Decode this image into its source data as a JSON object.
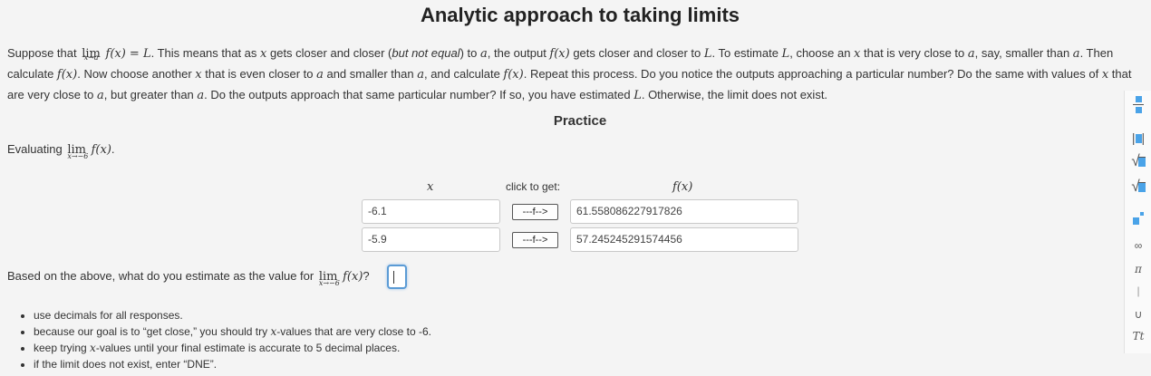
{
  "title": "Analytic approach to taking limits",
  "intro": {
    "s1a": "Suppose that ",
    "lim_word": "lim",
    "lim_sub": "x→a",
    "s1b": "f(x) = L",
    "s1c": ". This means that as ",
    "x": "x",
    "s1d": " gets closer and closer (",
    "s1e": "but not equal",
    "s1f": ") to ",
    "a": "a",
    "s1g": ", the output ",
    "fx": "f(x)",
    "s1h": " gets closer and closer to ",
    "L": "L",
    "s1i": ". To estimate ",
    "s1j": ", choose an ",
    "s1k": " that is very close to ",
    "s1l": ", say, smaller than ",
    "s1m": ". Then calculate ",
    "s2a": ". Now choose another ",
    "s2b": " that is even closer to ",
    "s2c": " and smaller than ",
    "s2d": ", and calculate ",
    "s2e": ". Repeat this process. Do you notice the outputs approaching a particular number? Do the same with values of ",
    "s2f": " that are very close to ",
    "s2g": ", but greater than ",
    "s2h": ". Do the outputs approach that same particular number? If so, you have estimated ",
    "s2i": ". Otherwise, the limit does not exist."
  },
  "practice_heading": "Practice",
  "evaluating": {
    "label": "Evaluating ",
    "lim_word": "lim",
    "lim_sub": "x→−6",
    "expr": "f(x)",
    "end": "."
  },
  "table": {
    "col_x": "x",
    "col_click": "click to get:",
    "col_f": "f(x)",
    "rows": [
      {
        "x": "-6.1",
        "button": "---f-->",
        "fx": "61.558086227917826"
      },
      {
        "x": "-5.9",
        "button": "---f-->",
        "fx": "57.245245291574456"
      }
    ]
  },
  "question": {
    "text": "Based on the above, what do you estimate as the value for ",
    "lim_word": "lim",
    "lim_sub": "x→−6",
    "expr": "f(x)",
    "end": "?",
    "answer_value": ""
  },
  "hints": {
    "h1": "use decimals for all responses.",
    "h2a": "because our goal is to “get close,” you should try ",
    "h2b": "-values that are very close to -6.",
    "h3a": "keep trying ",
    "h3b": "-values until your final estimate is accurate to 5 decimal places.",
    "h4": "if the limit does not exist, enter “DNE”."
  },
  "palette": {
    "infinity": "∞",
    "pi": "π",
    "bar": "|",
    "union": "∪",
    "text": "Tt",
    "abs_open": "|",
    "abs_close": "|",
    "sqrt": "√"
  },
  "colors": {
    "accent": "#4aa3e8",
    "focus": "#5b9bd5"
  }
}
